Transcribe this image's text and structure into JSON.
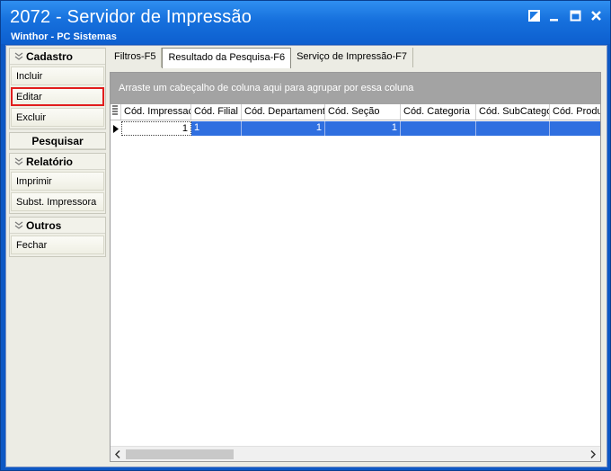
{
  "window": {
    "title": "2072 - Servidor de Impressão",
    "subtitle": "Winthor - PC Sistemas",
    "accent_color": "#1670dd"
  },
  "sidebar": {
    "groups": [
      {
        "header": "Cadastro",
        "items": [
          "Incluir",
          "Editar",
          "Excluir"
        ]
      },
      {
        "header": "Pesquisar",
        "items": []
      },
      {
        "header": "Relatório",
        "items": [
          "Imprimir",
          "Subst. Impressora"
        ]
      },
      {
        "header": "Outros",
        "items": [
          "Fechar"
        ]
      }
    ],
    "highlight_color": "#e11d1d"
  },
  "tabs": [
    "Filtros-F5",
    "Resultado da Pesquisa-F6",
    "Serviço de Impressão-F7"
  ],
  "active_tab": "Resultado da Pesquisa-F6",
  "grid": {
    "group_panel_text": "Arraste um cabeçalho de coluna aqui para agrupar por essa coluna",
    "columns": [
      "Cód. Impressac",
      "Cód. Filial",
      "Cód. Departament",
      "Cód. Seção",
      "Cód. Categoria",
      "Cód. SubCatego",
      "Cód. Produ"
    ],
    "rows": [
      [
        "1",
        "1",
        "1",
        "1",
        "",
        "",
        ""
      ]
    ],
    "selection_color": "#2f6fe0"
  }
}
